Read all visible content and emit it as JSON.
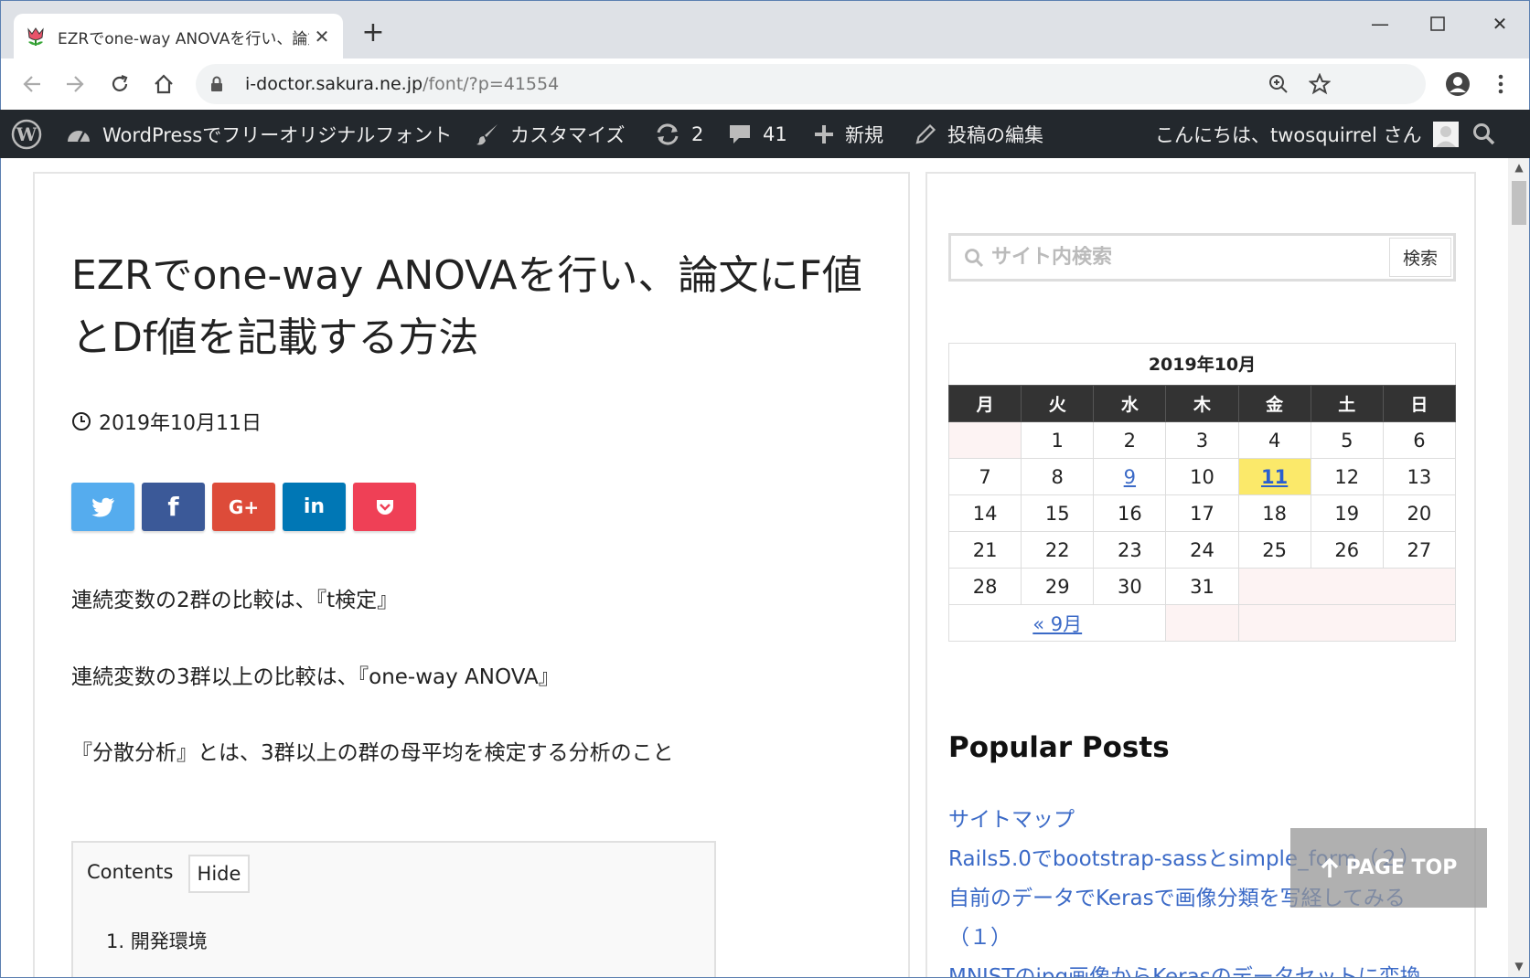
{
  "browser": {
    "tab_title": "EZRでone-way ANOVAを行い、論文にF値とDf値を記載する方法",
    "url_host": "i-doctor.sakura.ne.jp",
    "url_path": "/font/?p=41554"
  },
  "adminbar": {
    "site_name": "WordPressでフリーオリジナルフォント",
    "customize": "カスタマイズ",
    "updates_count": "2",
    "comments_count": "41",
    "new_label": "新規",
    "edit_label": "投稿の編集",
    "greeting": "こんにちは、twosquirrel さん"
  },
  "post": {
    "title": "EZRでone-way ANOVAを行い、論文にF値とDf値を記載する方法",
    "date": "2019年10月11日",
    "share": {
      "twitter": "",
      "facebook": "f",
      "gplus": "G+",
      "linkedin": "in",
      "pocket": ""
    },
    "paragraphs": [
      "連続変数の2群の比較は、『t検定』",
      "連続変数の3群以上の比較は、『one-way ANOVA』",
      "『分散分析』とは、3群以上の群の母平均を検定する分析のこと"
    ],
    "toc": {
      "title": "Contents",
      "hide_label": "Hide",
      "item1": "1. 開発環境"
    }
  },
  "sidebar": {
    "search_placeholder": "サイト内検索",
    "search_button": "検索",
    "calendar": {
      "caption": "2019年10月",
      "weekdays": [
        "月",
        "火",
        "水",
        "木",
        "金",
        "土",
        "日"
      ],
      "weeks": [
        [
          "",
          "1",
          "2",
          "3",
          "4",
          "5",
          "6"
        ],
        [
          "7",
          "8",
          "9",
          "10",
          "11",
          "12",
          "13"
        ],
        [
          "14",
          "15",
          "16",
          "17",
          "18",
          "19",
          "20"
        ],
        [
          "21",
          "22",
          "23",
          "24",
          "25",
          "26",
          "27"
        ],
        [
          "28",
          "29",
          "30",
          "31",
          "",
          "",
          ""
        ]
      ],
      "prev_link": "« 9月"
    },
    "popular_title": "Popular Posts",
    "popular_posts": [
      "サイトマップ",
      "Rails5.0でbootstrap-sassとsimple_form（２）",
      "自前のデータでKerasで画像分類を写経してみる",
      "（１）",
      "MNISTのjpg画像からKerasのデータセットに変換"
    ]
  },
  "pagetop_label": "PAGE TOP"
}
